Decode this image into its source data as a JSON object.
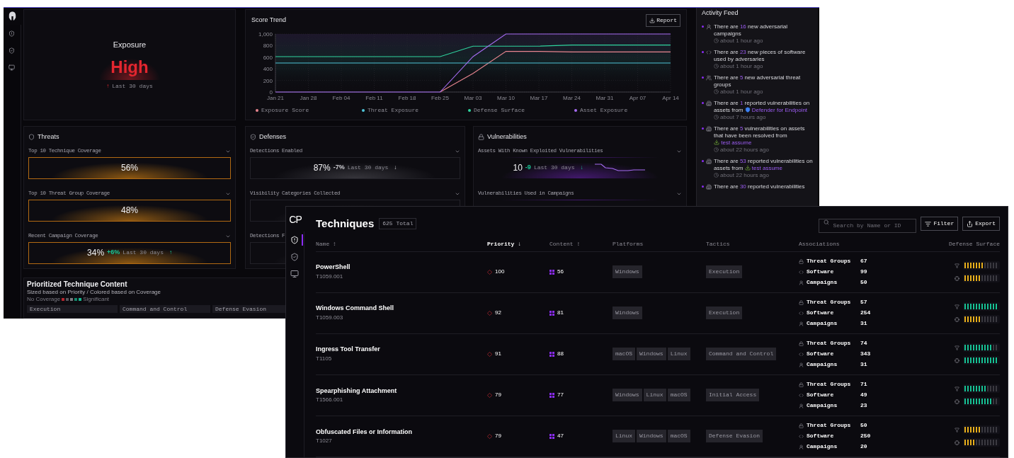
{
  "back_window": {
    "nav": [
      {
        "kind": "threats",
        "selected": false
      },
      {
        "kind": "defenses",
        "selected": false
      },
      {
        "kind": "assets",
        "selected": false
      }
    ],
    "exposure": {
      "title": "Exposure",
      "rating": "High",
      "trend_arrow": "↑",
      "trend_label": "Last 30 days"
    },
    "score_trend": {
      "title": "Score Trend",
      "report_button": "Report",
      "chart_data": {
        "type": "line",
        "grid": true,
        "legend": "bottom",
        "categories": [
          "Jan 21",
          "Jan 28",
          "Feb 04",
          "Feb 11",
          "Feb 18",
          "Feb 25",
          "Mar 03",
          "Mar 10",
          "Mar 17",
          "Mar 24",
          "Mar 31",
          "Apr 07",
          "Apr 14"
        ],
        "ylim": [
          0,
          1000
        ],
        "yticks": [
          0,
          200,
          400,
          600,
          800,
          {
            "value": 1000,
            "label": "1,000"
          }
        ],
        "series": [
          {
            "name": "Exposure Score",
            "color": "#e8858f",
            "values": [
              null,
              null,
              null,
              null,
              null,
              0,
              320,
              700,
              700,
              690,
              690,
              690,
              690
            ]
          },
          {
            "name": "Threat Exposure",
            "color": "#4fc4d8",
            "values": [
              500,
              500,
              500,
              500,
              500,
              500,
              500,
              500,
              500,
              500,
              500,
              500,
              500
            ]
          },
          {
            "name": "Defense Surface",
            "color": "#2fd49e",
            "values": [
              610,
              610,
              610,
              610,
              610,
              610,
              790,
              790,
              790,
              810,
              810,
              810,
              810
            ]
          },
          {
            "name": "Asset Exposure",
            "color": "#a66cf2",
            "values": [
              0,
              0,
              0,
              0,
              0,
              0,
              610,
              1000,
              1000,
              1000,
              1000,
              1000,
              1000
            ]
          }
        ]
      }
    },
    "threats": {
      "title": "Threats",
      "metrics": [
        {
          "label": "Top 10 Technique Coverage",
          "value": "56%",
          "expanded": false
        },
        {
          "label": "Top 10 Threat Group Coverage",
          "value": "48%",
          "expanded": false
        },
        {
          "label": "Recent Campaign Coverage",
          "value": "34%",
          "change": "+6%",
          "period": "Last 30 days",
          "arrow": "↑",
          "color": "#19c596",
          "expanded": false
        }
      ]
    },
    "defenses": {
      "title": "Defenses",
      "metrics": [
        {
          "label": "Detections Enabled",
          "value": "87%",
          "change": "-7%",
          "period": "Last 30 days",
          "arrow": "↓",
          "color": "#cfcfd4",
          "expanded": false
        },
        {
          "label": "Visibility Categories Collected",
          "expanded": false
        },
        {
          "label": "Detections F"
        }
      ]
    },
    "vulnerabilities": {
      "title": "Vulnerabilities",
      "metrics": [
        {
          "label": "Assets With Known Exploited Vulnerabilities",
          "value": "10",
          "change": "-9",
          "period": "Last 30 days",
          "arrow": "↓",
          "color": "#19c596",
          "sparkline": true,
          "expanded": false
        },
        {
          "label": "Vulnerabilities Used in Campaigns",
          "expanded": false
        }
      ]
    },
    "prioritized": {
      "title": "Prioritized Technique Content",
      "subtitle": "Sized based on Priority / Colored based on Coverage",
      "legend_low": "No Coverage",
      "legend_high": "Significant",
      "legend_swatches": [
        {
          "color": "#b3262e"
        },
        {
          "color": "#55555c"
        },
        {
          "color": "#7a7a80"
        },
        {
          "color": "#13876c"
        },
        {
          "color": "#18b58e"
        }
      ],
      "columns": [
        "Execution",
        "Command and Control",
        "Defense Evasion"
      ]
    },
    "activity_feed": {
      "title": "Activity Feed",
      "items": [
        {
          "kind": "campaign",
          "prefix": "There are ",
          "count": "16",
          "rest": " new adversarial campaigns",
          "time": "about 1 hour ago"
        },
        {
          "kind": "software",
          "prefix": "There are ",
          "count": "23",
          "rest": " new pieces of software used by adversaries",
          "time": "about 1 hour ago"
        },
        {
          "kind": "group",
          "prefix": "There are ",
          "count": "5",
          "rest": " new adversarial threat groups",
          "time": "about 1 hour ago"
        },
        {
          "kind": "vulnerability",
          "prefix": "There are ",
          "count": "1",
          "rest": " reported vulnerabilities on assets from ",
          "link": {
            "kind": "shield",
            "text": "Defender for Endpoint"
          },
          "time": "about 7 hours ago"
        },
        {
          "kind": "vulnerability",
          "prefix": "There are ",
          "count": "5",
          "rest": " vulnerabilities on assets that have been resolved from ",
          "link": {
            "kind": "arrow",
            "text": "test assume"
          },
          "time": "about 22 hours ago"
        },
        {
          "kind": "vulnerability",
          "prefix": "There are ",
          "count": "53",
          "rest": " reported vulnerabilities on assets from ",
          "link": {
            "kind": "arrow",
            "text": "test assume"
          },
          "time": "about 22 hours ago"
        },
        {
          "kind": "vulnerability",
          "prefix": "There are ",
          "count": "30",
          "rest": " reported vulnerabilities"
        }
      ]
    }
  },
  "front_window": {
    "logo": "CP",
    "nav": [
      {
        "kind": "threats",
        "selected": true
      },
      {
        "kind": "defenses",
        "selected": false
      },
      {
        "kind": "assets",
        "selected": false
      }
    ],
    "title": "Techniques",
    "total": "625 Total",
    "search": {
      "placeholder": "Search by Name or ID"
    },
    "filter_button": "Filter",
    "export_button": "Export",
    "columns": [
      {
        "label": "Name ↕",
        "sorted": false
      },
      {
        "label": "Priority ↓",
        "sorted": true
      },
      {
        "label": "Content ↕",
        "sorted": false
      },
      {
        "label": "Platforms",
        "sorted": false
      },
      {
        "label": "Tactics",
        "sorted": false
      },
      {
        "label": "Associations",
        "sorted": false
      },
      {
        "label": "Defense Surface",
        "sorted": false
      }
    ],
    "rows": [
      {
        "name": "PowerShell",
        "id": "T1059.001",
        "priority": "100",
        "content": "56",
        "platforms": [
          "Windows"
        ],
        "tactics": [
          "Execution"
        ],
        "associations": [
          {
            "kind": "groups",
            "label": "Threat Groups",
            "count": "67"
          },
          {
            "kind": "software",
            "label": "Software",
            "count": "99"
          },
          {
            "kind": "campaigns",
            "label": "Campaigns",
            "count": "50"
          }
        ],
        "defense": [
          {
            "kind": "detection",
            "level": 0.58,
            "color": "#e9b01c"
          },
          {
            "kind": "visibility",
            "level": 0.5,
            "color": "#e9b01c"
          }
        ]
      },
      {
        "name": "Windows Command Shell",
        "id": "T1059.003",
        "priority": "92",
        "content": "81",
        "platforms": [
          "Windows"
        ],
        "tactics": [
          "Execution"
        ],
        "associations": [
          {
            "kind": "groups",
            "label": "Threat Groups",
            "count": "57"
          },
          {
            "kind": "software",
            "label": "Software",
            "count": "254"
          },
          {
            "kind": "campaigns",
            "label": "Campaigns",
            "count": "31"
          }
        ],
        "defense": [
          {
            "kind": "detection",
            "level": 1,
            "color": "#17c295"
          },
          {
            "kind": "visibility",
            "level": 0.5,
            "color": "#e9b01c"
          }
        ]
      },
      {
        "name": "Ingress Tool Transfer",
        "id": "T1105",
        "priority": "91",
        "content": "88",
        "platforms": [
          "macOS",
          "Windows",
          "Linux"
        ],
        "tactics": [
          "Command and Control"
        ],
        "associations": [
          {
            "kind": "groups",
            "label": "Threat Groups",
            "count": "74"
          },
          {
            "kind": "software",
            "label": "Software",
            "count": "343"
          },
          {
            "kind": "campaigns",
            "label": "Campaigns",
            "count": "31"
          }
        ],
        "defense": [
          {
            "kind": "detection",
            "level": 0.83,
            "color": "#17c295"
          },
          {
            "kind": "visibility",
            "level": 1,
            "color": "#17c295"
          }
        ]
      },
      {
        "name": "Spearphishing Attachment",
        "id": "T1566.001",
        "priority": "79",
        "content": "77",
        "platforms": [
          "Windows",
          "Linux",
          "macOS"
        ],
        "tactics": [
          "Initial Access"
        ],
        "associations": [
          {
            "kind": "groups",
            "label": "Threat Groups",
            "count": "71"
          },
          {
            "kind": "software",
            "label": "Software",
            "count": "49"
          },
          {
            "kind": "campaigns",
            "label": "Campaigns",
            "count": "23"
          }
        ],
        "defense": [
          {
            "kind": "detection",
            "level": 0.67,
            "color": "#17c295"
          },
          {
            "kind": "visibility",
            "level": 0.83,
            "color": "#17c295"
          }
        ]
      },
      {
        "name": "Obfuscated Files or Information",
        "id": "T1027",
        "priority": "79",
        "content": "47",
        "platforms": [
          "Linux",
          "Windows",
          "macOS"
        ],
        "tactics": [
          "Defense Evasion"
        ],
        "associations": [
          {
            "kind": "groups",
            "label": "Threat Groups",
            "count": "50"
          },
          {
            "kind": "software",
            "label": "Software",
            "count": "250"
          },
          {
            "kind": "campaigns",
            "label": "Campaigns",
            "count": "20"
          }
        ],
        "defense": [
          {
            "kind": "detection",
            "level": 0.5,
            "color": "#e9b01c"
          },
          {
            "kind": "visibility",
            "level": 0.33,
            "color": "#e9b01c"
          }
        ]
      }
    ]
  }
}
